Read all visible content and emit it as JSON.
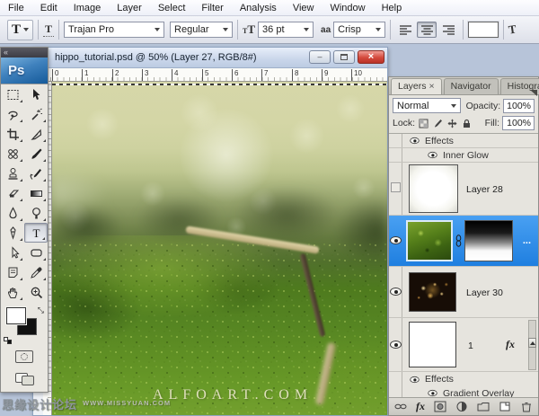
{
  "menu_bar": {
    "items": [
      "File",
      "Edit",
      "Image",
      "Layer",
      "Select",
      "Filter",
      "Analysis",
      "View",
      "Window",
      "Help"
    ]
  },
  "options_bar": {
    "tool_letter": "T",
    "orientation_letter": "T",
    "font_family": "Trajan Pro",
    "font_style": "Regular",
    "size_glyph": "T",
    "font_size": "36 pt",
    "anti_alias_glyph": "aa",
    "anti_alias": "Crisp",
    "warp_glyph": "T",
    "color_swatch": "#ffffff"
  },
  "document_window": {
    "collapse_arrows": "«",
    "title": "hippo_tutorial.psd @ 50% (Layer 27, RGB/8#)",
    "minimize_glyph": "–",
    "ruler_numbers": [
      "0",
      "1",
      "2",
      "3",
      "4",
      "5",
      "6",
      "7",
      "8",
      "9",
      "10"
    ],
    "watermark": {
      "cn": "思缘设计论坛",
      "site": "WWW.MISSYUAN.COM",
      "brand": "ALFOART.COM"
    }
  },
  "toolbox": {
    "logo": "Ps",
    "tools": [
      "rectangular-marquee",
      "move",
      "lasso",
      "magic-wand",
      "crop",
      "slice",
      "healing-brush",
      "brush",
      "clone-stamp",
      "history-brush",
      "eraser",
      "gradient",
      "blur",
      "dodge",
      "pen",
      "type",
      "path-selection",
      "shape",
      "notes",
      "eyedropper",
      "hand",
      "zoom"
    ],
    "foreground_color": "#ffffff",
    "background_color": "#000000"
  },
  "layers_panel": {
    "tabs": [
      {
        "label": "Layers",
        "close": "×"
      },
      {
        "label": "Navigator"
      },
      {
        "label": "Histogram"
      }
    ],
    "blend_mode": "Normal",
    "opacity_label": "Opacity:",
    "opacity": "100%",
    "lock_label": "Lock:",
    "fill_label": "Fill:",
    "fill": "100%",
    "rows": {
      "effects_top": "Effects",
      "inner_glow": "Inner Glow",
      "layer28": "Layer 28",
      "selected_more": "...",
      "layer30": "Layer 30",
      "layer1": "1",
      "layer1_fx": "fx",
      "effects_bottom": "Effects",
      "gradient_overlay": "Gradient Overlay"
    },
    "bottom_icons": [
      "link-layers",
      "add-layer-style",
      "add-layer-mask",
      "new-adjustment-layer",
      "new-group",
      "new-layer",
      "delete-layer"
    ],
    "selection_blue": "#2f8fea"
  }
}
